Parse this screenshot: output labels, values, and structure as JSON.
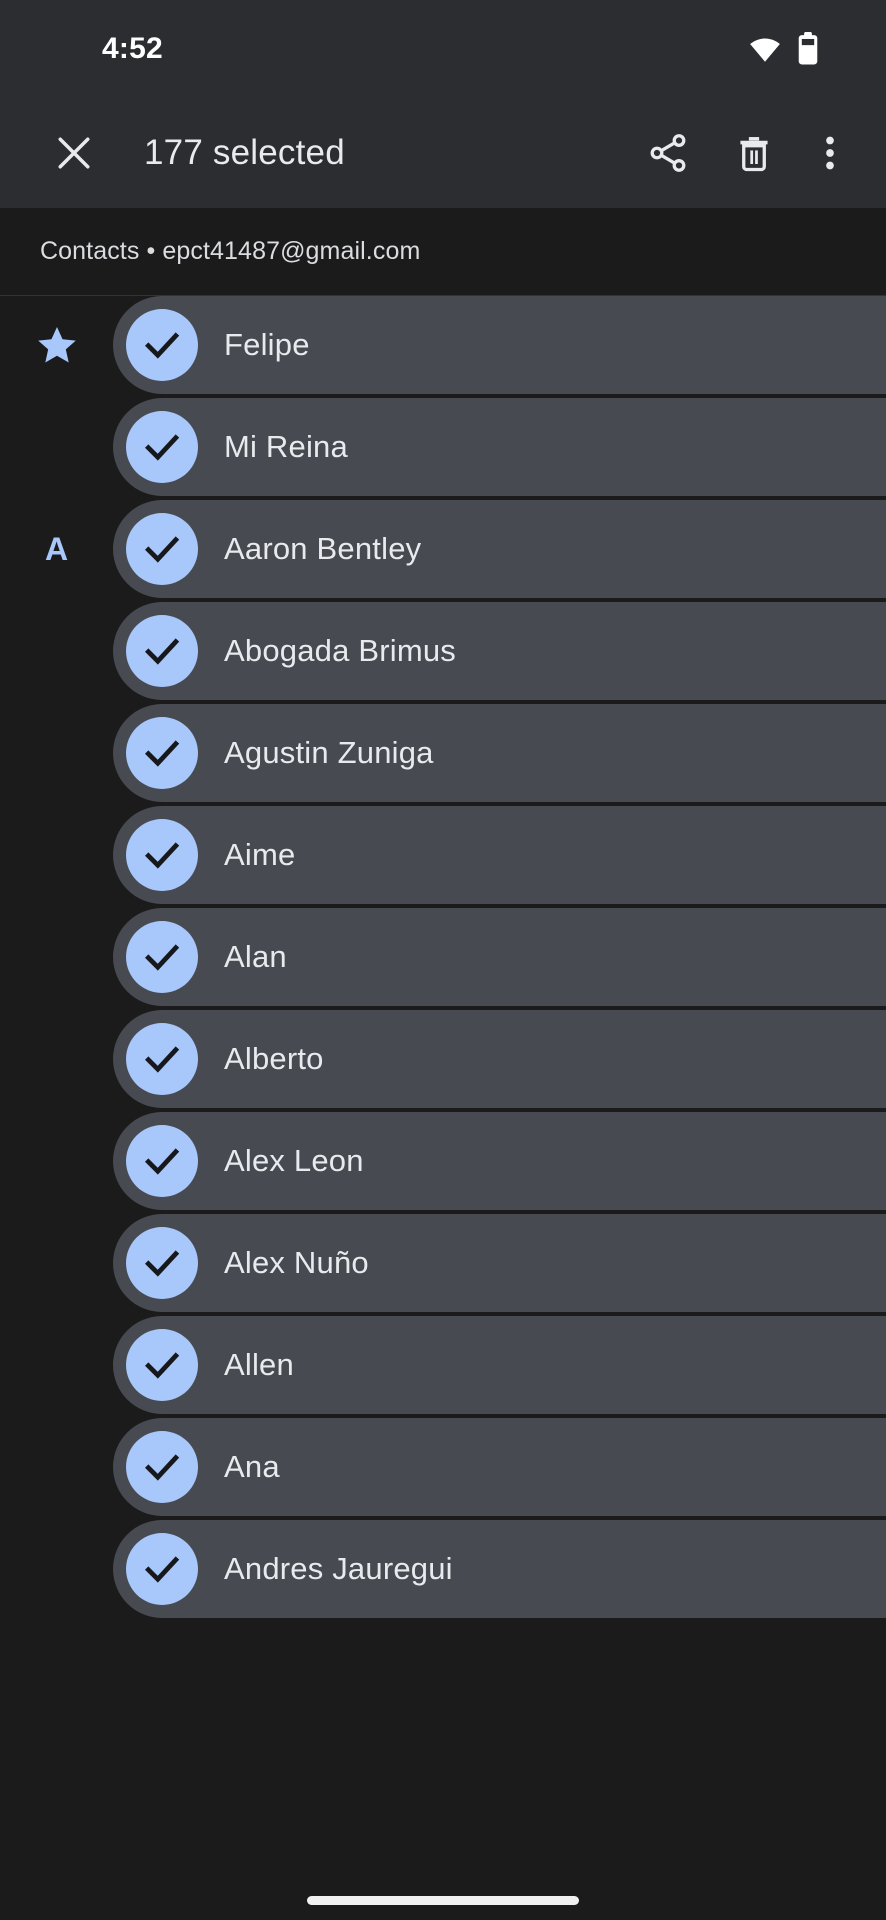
{
  "statusbar": {
    "time": "4:52",
    "icons": [
      "wifi-icon",
      "battery-icon"
    ]
  },
  "actionbar": {
    "close_label": "close-icon",
    "title": "177 selected",
    "actions": [
      {
        "name": "share",
        "label": "Share"
      },
      {
        "name": "delete",
        "label": "Delete"
      },
      {
        "name": "more",
        "label": "More options"
      }
    ]
  },
  "account": {
    "label": "Contacts • epct41487@gmail.com"
  },
  "colors": {
    "accent": "#a8c7fa",
    "row_background": "#474a51",
    "page_background": "#1b1b1b",
    "bar_background": "#2b2d31",
    "primary_text": "#e8eaed"
  },
  "list": {
    "rows": [
      {
        "section": "star",
        "name": "Felipe",
        "checked": true
      },
      {
        "section": "",
        "name": "Mi Reina",
        "checked": true
      },
      {
        "section": "A",
        "name": "Aaron Bentley",
        "checked": true
      },
      {
        "section": "",
        "name": "Abogada Brimus",
        "checked": true
      },
      {
        "section": "",
        "name": "Agustin Zuniga",
        "checked": true
      },
      {
        "section": "",
        "name": "Aime",
        "checked": true
      },
      {
        "section": "",
        "name": "Alan",
        "checked": true
      },
      {
        "section": "",
        "name": "Alberto",
        "checked": true
      },
      {
        "section": "",
        "name": "Alex Leon",
        "checked": true
      },
      {
        "section": "",
        "name": "Alex Nuño",
        "checked": true
      },
      {
        "section": "",
        "name": "Allen",
        "checked": true
      },
      {
        "section": "",
        "name": "Ana",
        "checked": true
      },
      {
        "section": "",
        "name": "Andres Jauregui",
        "checked": true
      }
    ]
  }
}
